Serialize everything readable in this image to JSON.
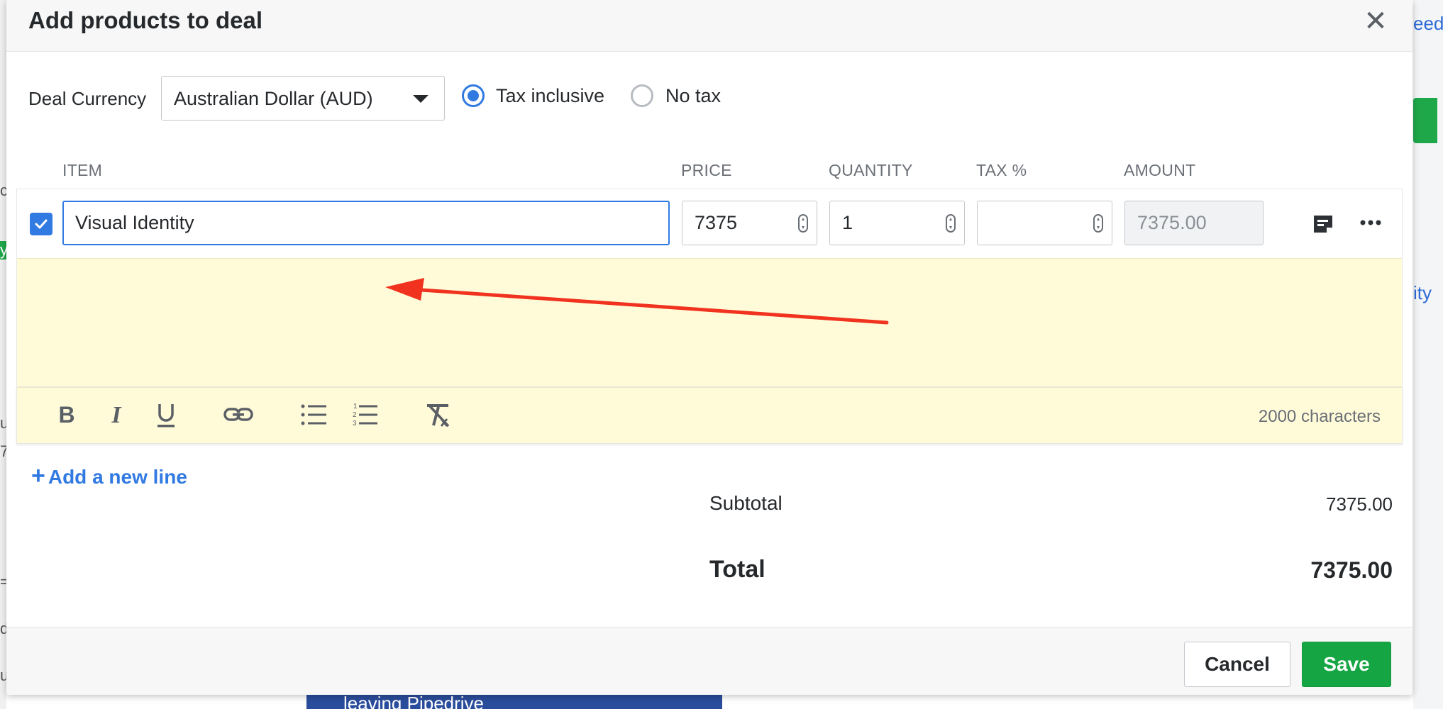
{
  "modal": {
    "title": "Add products to deal",
    "close_symbol": "✕"
  },
  "currency": {
    "label": "Deal Currency",
    "selected": "Australian Dollar (AUD)"
  },
  "tax_mode": {
    "options": [
      {
        "label": "Tax inclusive",
        "checked": true
      },
      {
        "label": "No tax",
        "checked": false
      }
    ]
  },
  "columns": {
    "item": "ITEM",
    "price": "PRICE",
    "quantity": "QUANTITY",
    "tax": "TAX %",
    "amount": "AMOUNT"
  },
  "line": {
    "checked": true,
    "item_name": "Visual Identity",
    "price": "7375",
    "quantity": "1",
    "tax": "",
    "amount": "7375.00"
  },
  "note_editor": {
    "toolbar": [
      "bold-icon",
      "italic-icon",
      "underline-icon",
      "link-icon",
      "bulleted-list-icon",
      "numbered-list-icon",
      "clear-format-icon"
    ],
    "char_count": "2000 characters"
  },
  "add_line": {
    "plus": "+",
    "label": "Add a new line"
  },
  "summary": {
    "subtotal_label": "Subtotal",
    "subtotal_value": "7375.00",
    "total_label": "Total",
    "total_value": "7375.00"
  },
  "footer": {
    "cancel_label": "Cancel",
    "save_label": "Save"
  },
  "background": {
    "right_snippets": [
      "eed",
      "ity"
    ],
    "bottom_banner": "leaving Pipedrive",
    "left_chars": [
      "c",
      "y",
      "u",
      "7",
      "=",
      "d",
      "u"
    ]
  },
  "colors": {
    "accent": "#317ae2",
    "save_green": "#16a543",
    "note_bg": "#fffbd9",
    "annotation_arrow": "#f0321e"
  }
}
